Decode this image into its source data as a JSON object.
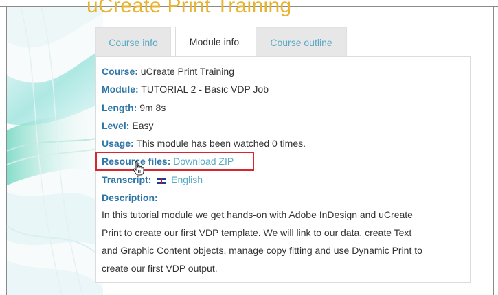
{
  "page": {
    "title": "uCreate Print Training"
  },
  "tabs": [
    {
      "label": "Course info",
      "active": false
    },
    {
      "label": "Module info",
      "active": true
    },
    {
      "label": "Course outline",
      "active": false
    }
  ],
  "module_info": {
    "course": {
      "label": "Course:",
      "value": "uCreate Print Training"
    },
    "module": {
      "label": "Module:",
      "value": "TUTORIAL 2 - Basic VDP Job"
    },
    "length": {
      "label": "Length:",
      "value": "9m 8s"
    },
    "level": {
      "label": "Level:",
      "value": "Easy"
    },
    "usage": {
      "label": "Usage:",
      "value": "This module has been watched 0 times."
    },
    "resource_files": {
      "label": "Resource files:",
      "link": "Download ZIP"
    },
    "transcript": {
      "label": "Transcript:",
      "link": "English",
      "flag_icon": "uk-flag-icon"
    },
    "description": {
      "label": "Description:",
      "lines": [
        "In this tutorial module we get hands-on with Adobe InDesign and uCreate",
        "Print to create our first VDP template. We will link to our data, create Text",
        "and Graphic Content objects, manage copy fitting and use Dynamic Print to",
        "create our first VDP output."
      ]
    }
  },
  "colors": {
    "title": "#e8b430",
    "label": "#2e76a8",
    "link": "#5aa9c7",
    "highlight_box": "#d8262e",
    "text": "#333333"
  }
}
